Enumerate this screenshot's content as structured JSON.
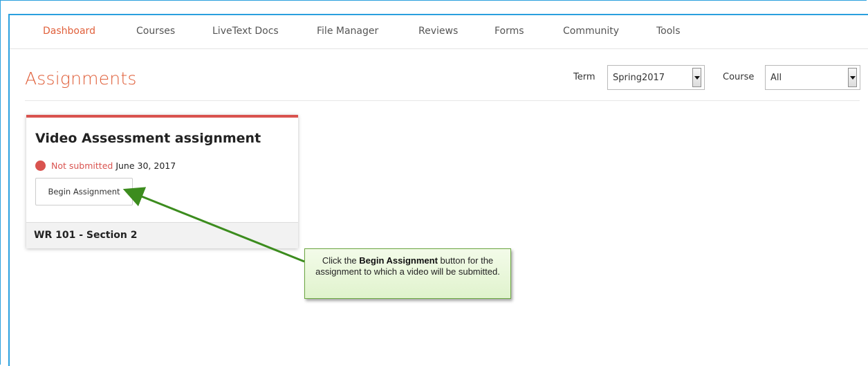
{
  "nav": {
    "items": [
      {
        "label": "Dashboard",
        "active": true
      },
      {
        "label": "Courses"
      },
      {
        "label": "LiveText Docs"
      },
      {
        "label": "File Manager"
      },
      {
        "label": "Reviews"
      },
      {
        "label": "Forms"
      },
      {
        "label": "Community"
      },
      {
        "label": "Tools"
      }
    ]
  },
  "page": {
    "title": "Assignments"
  },
  "filters": {
    "term_label": "Term",
    "term_value": "Spring2017",
    "course_label": "Course",
    "course_value": "All"
  },
  "assignment_card": {
    "title": "Video Assessment assignment",
    "status": "Not submitted",
    "due_date": "June 30, 2017",
    "button_label": "Begin Assignment",
    "section": "WR 101 - Section 2"
  },
  "callout": {
    "text_before": "Click the ",
    "bold_text": "Begin Assignment",
    "text_after": " button for the assignment to which a video will be submitted."
  },
  "colors": {
    "accent": "#e0603b",
    "status_red": "#d9534f",
    "frame_blue": "#2aa0de",
    "callout_green": "#6aa63f",
    "arrow_green": "#3c8c1e"
  }
}
